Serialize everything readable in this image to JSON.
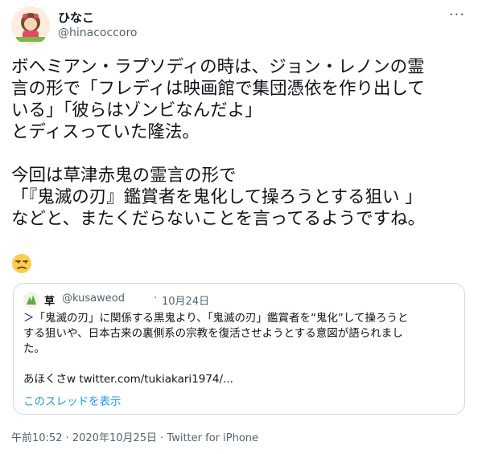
{
  "author": {
    "display_name": "ひなこ",
    "handle": "@hinacoccoro"
  },
  "more_label": "···",
  "tweet": {
    "text": "ボヘミアン・ラプソディの時は、ジョン・レノンの霊\n言の形で「フレディは映画館で集団憑依を作り出して\nいる」「彼らはゾンビなんだよ」\nとディスっていた隆法。\n\n今回は草津赤鬼の霊言の形で\n「『鬼滅の刃』鑑賞者を鬼化して操ろうとする狙い 」\nなどと、またくだらないことを言ってるようですね。",
    "emoji": "unamused-face"
  },
  "quote": {
    "display_name": "草",
    "handle": "@kusaweod",
    "separator": "·",
    "date": "10月24日",
    "text": "＞「鬼滅の刃」に関係する黒鬼より、「鬼滅の刃」鑑賞者を“鬼化”して操ろうと\nする狙いや、日本古来の裏側系の宗教を復活させようとする意図が語られまし\nた。\n\nあほくさw twitter.com/tukiakari1974/...",
    "show_thread": "このスレッドを表示"
  },
  "footer": {
    "timestamp": "午前10:52 · 2020年10月25日 · Twitter for iPhone"
  },
  "colors": {
    "accent": "#1d9bf0",
    "muted": "#536471",
    "border": "#cfd9de"
  }
}
